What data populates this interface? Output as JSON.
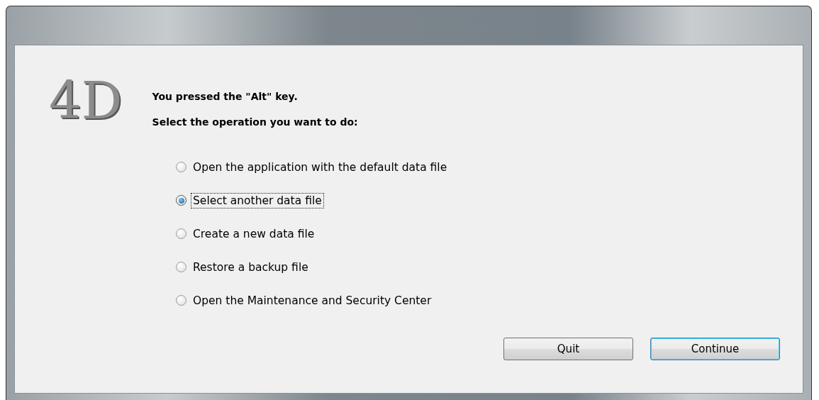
{
  "logo": {
    "text": "4D"
  },
  "message": {
    "title": "You pressed the \"Alt\" key.",
    "prompt": "Select the operation you want to do:"
  },
  "options": [
    {
      "label": "Open the application with the default data file",
      "selected": false,
      "focused": false
    },
    {
      "label": "Select another data file",
      "selected": true,
      "focused": true
    },
    {
      "label": "Create a new data file",
      "selected": false,
      "focused": false
    },
    {
      "label": "Restore a backup file",
      "selected": false,
      "focused": false
    },
    {
      "label": "Open the Maintenance and Security Center",
      "selected": false,
      "focused": false
    }
  ],
  "buttons": [
    {
      "label": "Quit",
      "default": false
    },
    {
      "label": "Continue",
      "default": true
    }
  ]
}
